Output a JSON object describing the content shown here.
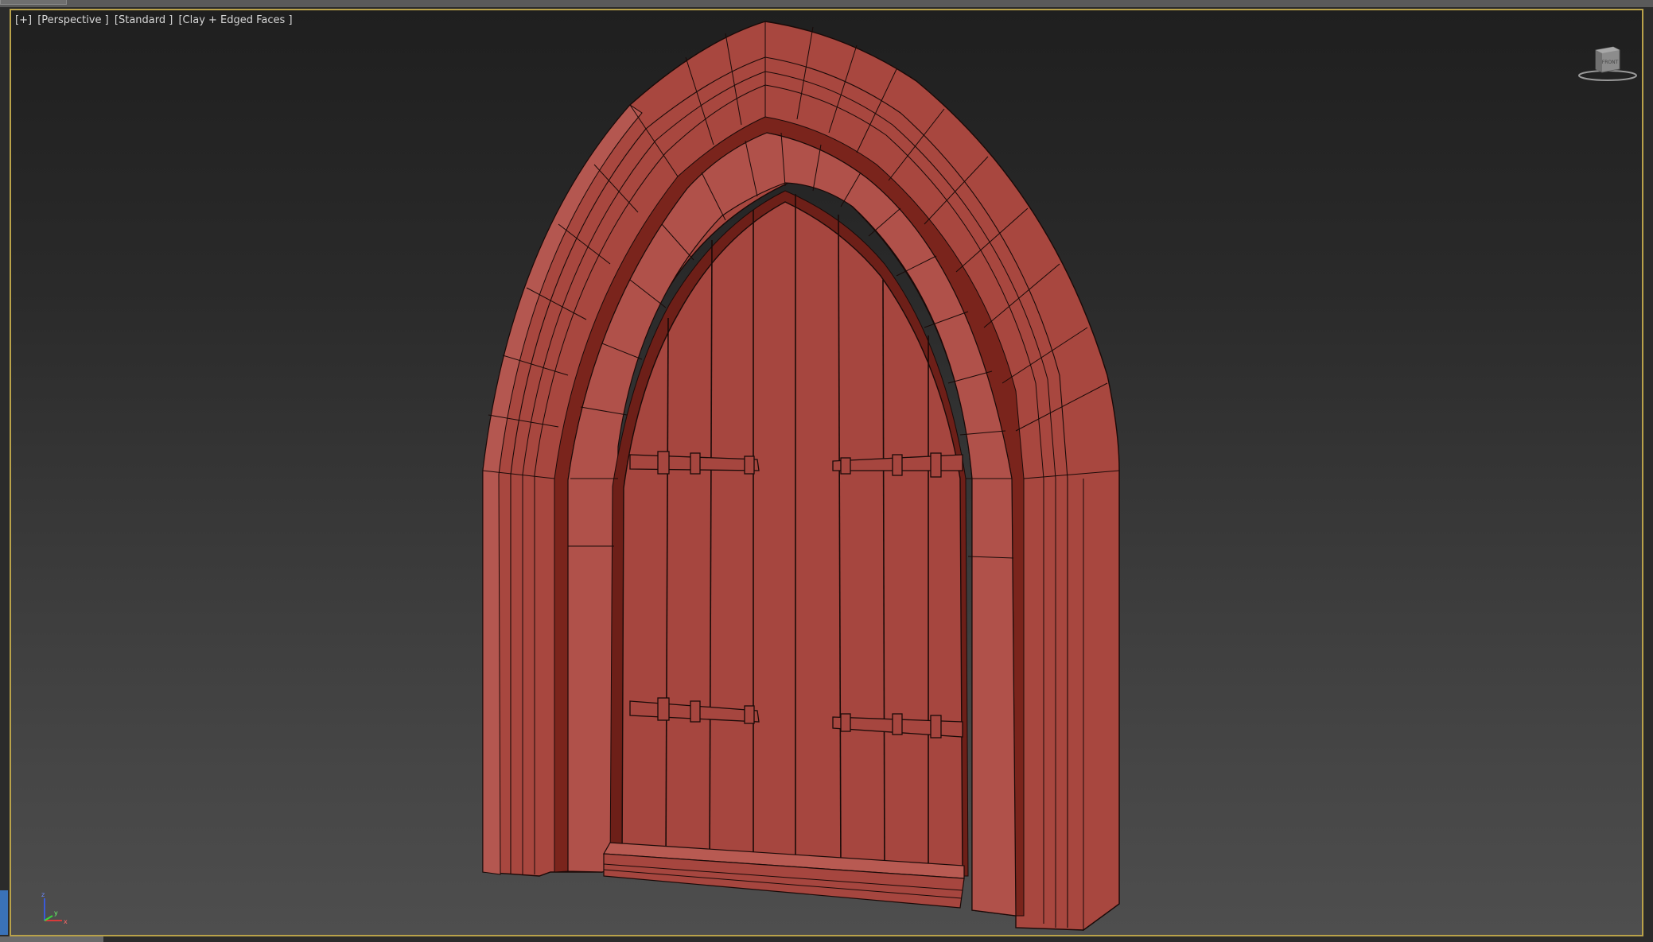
{
  "viewport": {
    "labels": [
      "[+]",
      "[Perspective ]",
      "[Standard ]",
      "[Clay + Edged Faces ]"
    ],
    "border_color": "#b9a24a",
    "view_name": "Perspective"
  },
  "viewcube": {
    "face_label": "FRONT"
  },
  "axis_tripod": {
    "z_label": "z",
    "x_label": "x",
    "y_label": "y"
  },
  "colors": {
    "clay": "#a8473f",
    "clay_dark": "#7a241c",
    "clay_light": "#b85a52",
    "edge": "#1a0a08"
  },
  "icons": [
    "viewcube-icon",
    "axis-tripod-icon"
  ]
}
